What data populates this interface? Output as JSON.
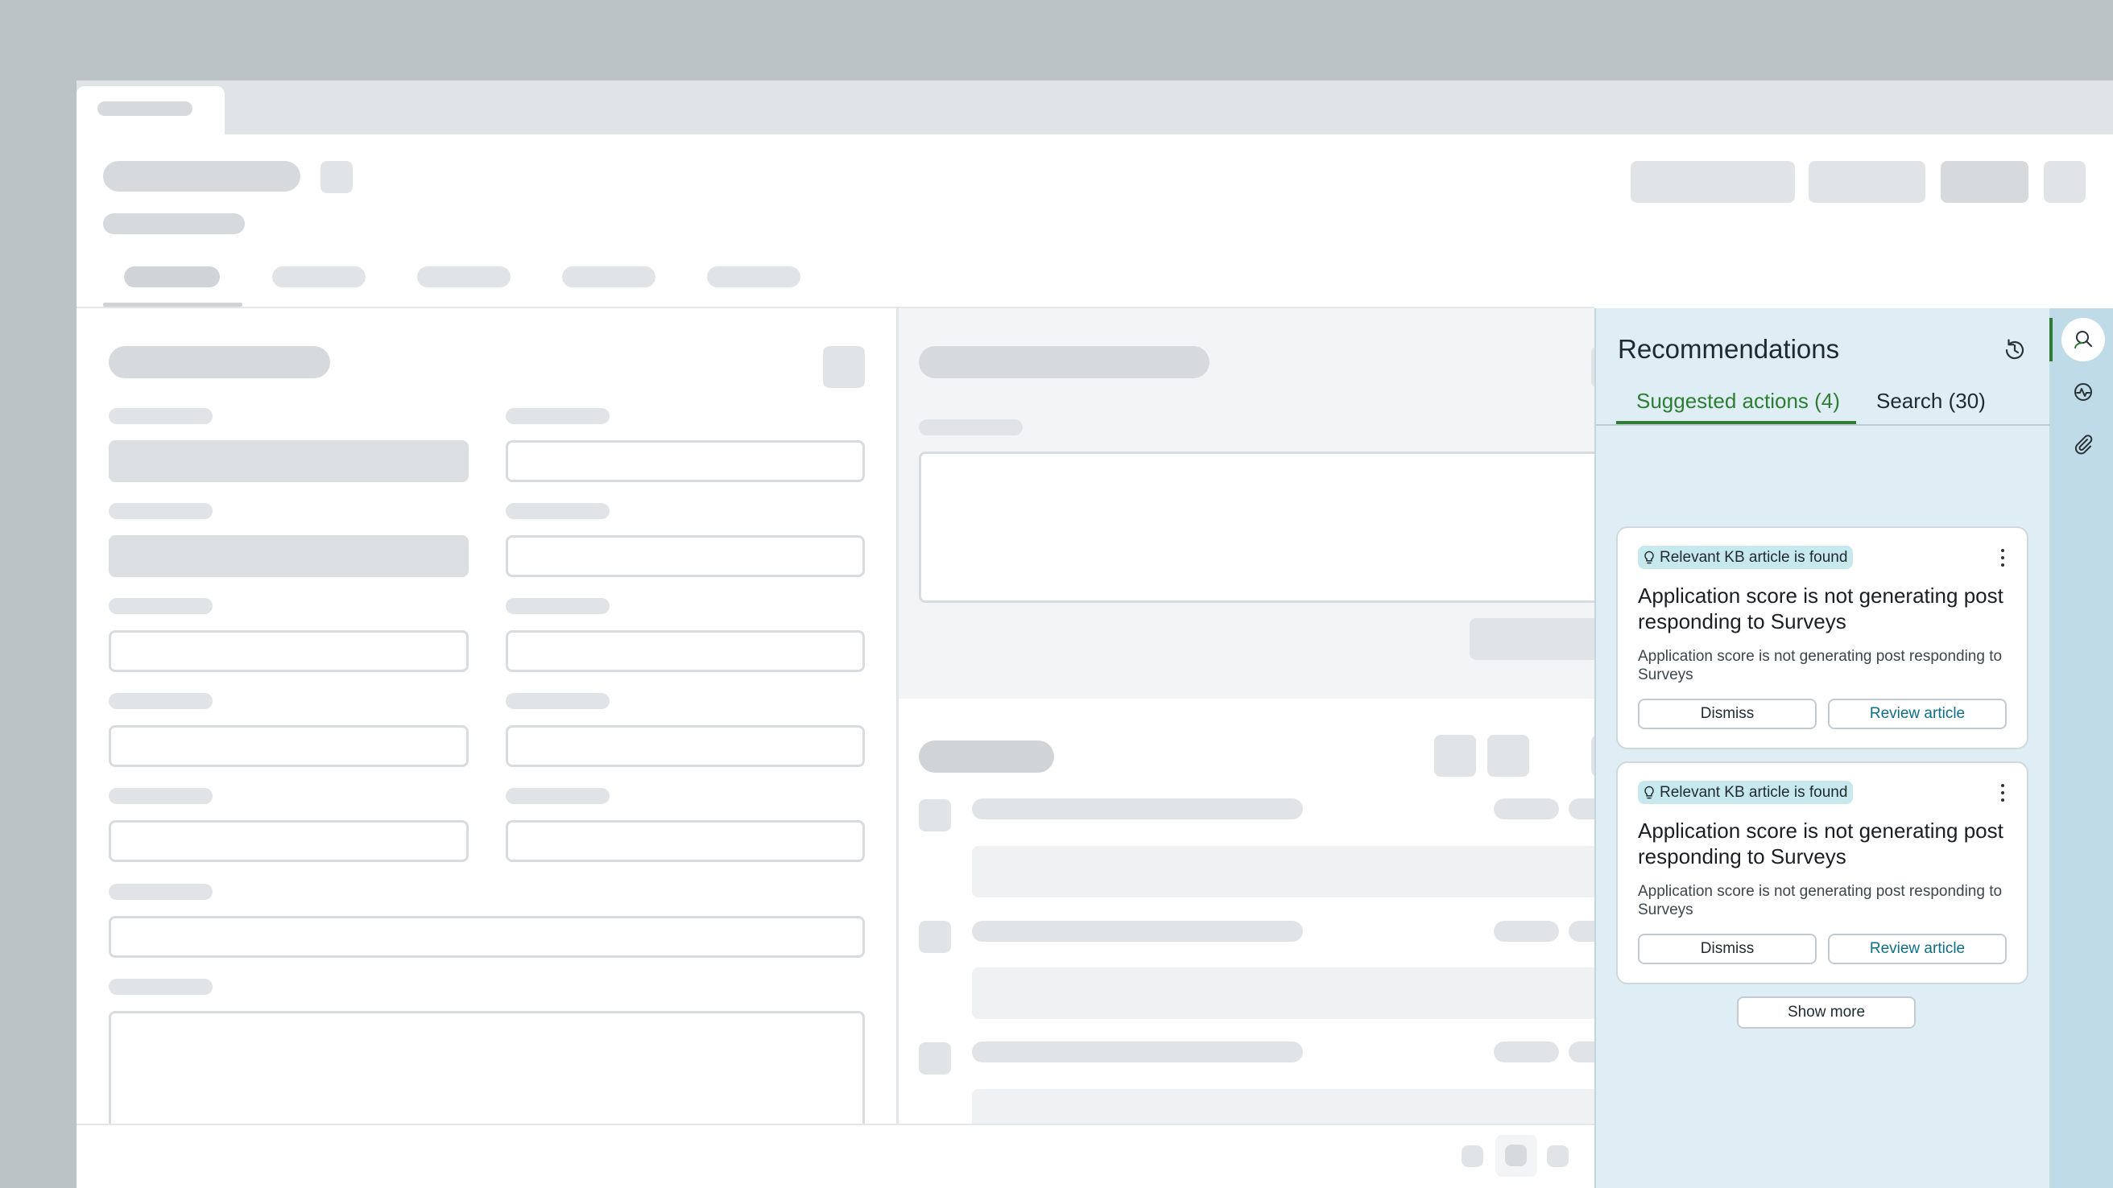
{
  "recommendations": {
    "title": "Recommendations",
    "tabs": [
      {
        "label": "Suggested actions (4)",
        "active": true
      },
      {
        "label": "Search (30)",
        "active": false
      }
    ],
    "cards": [
      {
        "badge": "Relevant KB article is found",
        "title": "Application score is not generating post responding to Surveys",
        "description": "Application score is not generating post responding to Surveys",
        "dismiss_label": "Dismiss",
        "review_label": "Review article"
      },
      {
        "badge": "Relevant KB article is found",
        "title": "Application score is not generating post responding to Surveys",
        "description": "Application score is not generating post responding to Surveys",
        "dismiss_label": "Dismiss",
        "review_label": "Review article"
      }
    ],
    "show_more_label": "Show more"
  },
  "rail": {
    "items": [
      "recommendations-icon",
      "activity-icon",
      "attachment-icon"
    ]
  },
  "colors": {
    "accent_green": "#2e7d32",
    "link_teal": "#0b6f87",
    "panel_bg": "#dfeef5",
    "badge_bg": "#c7e9ed"
  }
}
